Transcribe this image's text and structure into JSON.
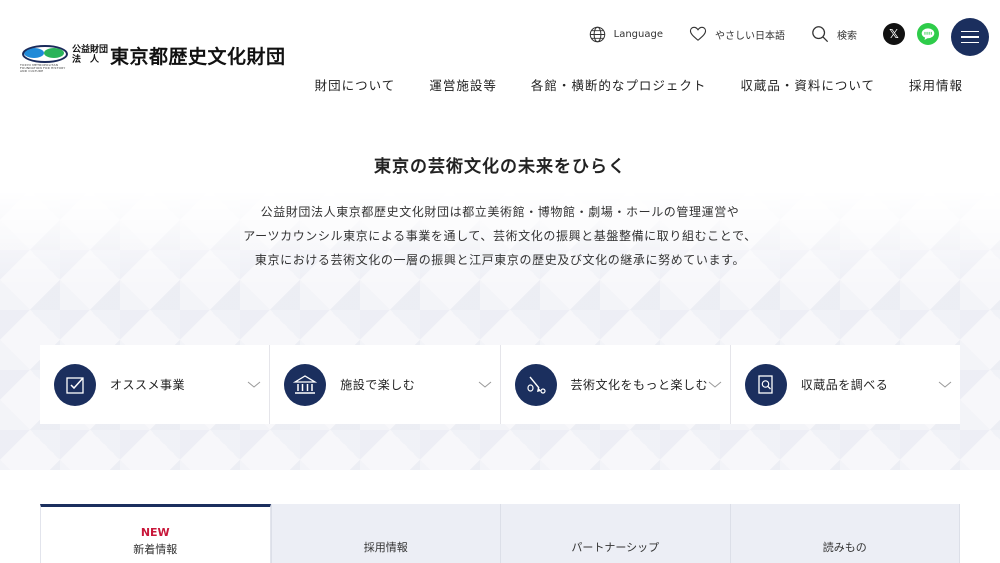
{
  "header": {
    "logo": {
      "prefix_line1": "公益財団",
      "prefix_line2": "法　人",
      "name": "東京都歴史文化財団",
      "tiny_text": "TOKYO METROPOLITAN FOUNDATION FOR HISTORY AND CULTURE"
    },
    "utility": {
      "language_label": "Language",
      "easy_japanese_label": "やさしい日本語",
      "search_label": "検索"
    },
    "colors": {
      "navy": "#1b2f5e",
      "line_green": "#2ecc4a",
      "x_black": "#111111"
    },
    "nav": [
      {
        "label": "財団について"
      },
      {
        "label": "運営施設等"
      },
      {
        "label": "各館・横断的なプロジェクト"
      },
      {
        "label": "収蔵品・資料について"
      },
      {
        "label": "採用情報"
      }
    ]
  },
  "intro": {
    "title": "東京の芸術文化の未来をひらく",
    "lines": [
      "公益財団法人東京都歴史文化財団は都立美術館・博物館・劇場・ホールの管理運営や",
      "アーツカウンシル東京による事業を通して、芸術文化の振興と基盤整備に取り組むことで、",
      "東京における芸術文化の一層の振興と江戸東京の歴史及び文化の継承に努めています。"
    ]
  },
  "cards": [
    {
      "label": "オススメ事業",
      "icon": "check-frame-icon"
    },
    {
      "label": "施設で楽しむ",
      "icon": "museum-building-icon"
    },
    {
      "label": "芸術文化をもっと楽しむ",
      "icon": "brush-palette-icon"
    },
    {
      "label": "収蔵品を調べる",
      "icon": "document-search-icon"
    }
  ],
  "tabs": [
    {
      "badge": "NEW",
      "label": "新着情報",
      "active": true
    },
    {
      "label": "採用情報"
    },
    {
      "label": "パートナーシップ"
    },
    {
      "label": "読みもの"
    }
  ]
}
